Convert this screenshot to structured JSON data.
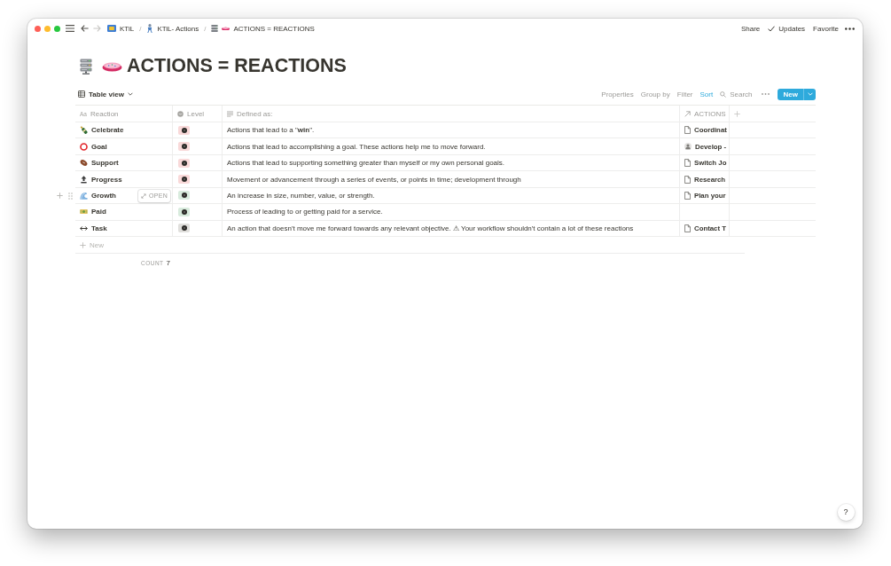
{
  "window": {
    "nav": [
      {
        "kind": "back",
        "disabled": false
      },
      {
        "kind": "forward",
        "disabled": true
      }
    ],
    "breadcrumbs": [
      {
        "label": "KTiL"
      },
      {
        "label": "KTiL- Actions",
        "separator": "/"
      },
      {
        "label": "ACTIONS = REACTIONS",
        "separator": "/"
      }
    ],
    "top_actions": [
      {
        "label": "Share",
        "kind": "plain"
      },
      {
        "label": "Updates",
        "kind": "check"
      },
      {
        "label": "Favorite",
        "kind": "plain"
      }
    ]
  },
  "page": {
    "title": "ACTIONS = REACTIONS"
  },
  "view": {
    "label": "Table view"
  },
  "toolbar": [
    {
      "label": "Properties",
      "kind": "plain",
      "active": false
    },
    {
      "label": "Group by",
      "kind": "plain",
      "active": false
    },
    {
      "label": "Filter",
      "kind": "plain",
      "active": false
    },
    {
      "label": "Sort",
      "kind": "plain",
      "active": true
    },
    {
      "label": "Search",
      "kind": "search",
      "active": false
    }
  ],
  "new_button": {
    "label": "New"
  },
  "table": {
    "columns": [
      {
        "label": "Reaction",
        "kind": "title",
        "glyph": "Aa"
      },
      {
        "label": "Level",
        "kind": "select"
      },
      {
        "label": "Defined as:",
        "kind": "text"
      },
      {
        "label": "ACTIONS",
        "kind": "relation"
      }
    ],
    "rows": [
      {
        "name": "Celebrate",
        "color": "#f9d9d9",
        "definition": "Actions that lead to a \"**win**\".",
        "action": {
          "title": "Coordinat",
          "kind": "page"
        },
        "hovered": false
      },
      {
        "name": "Goal",
        "color": "#f9d9d9",
        "definition": "Actions that lead to accomplishing a goal. These actions help me to move forward.",
        "action": {
          "title": "Develop -",
          "kind": "avatar"
        },
        "hovered": false
      },
      {
        "name": "Support",
        "color": "#f9d9d9",
        "definition": "Actions that lead to supporting something greater than myself or my own personal goals.",
        "action": {
          "title": "Switch Jo",
          "kind": "page"
        },
        "hovered": false
      },
      {
        "name": "Progress",
        "color": "#f9d9d9",
        "definition": "Movement or advancement through a series of events, or points in time; development through",
        "action": {
          "title": "Research",
          "kind": "page"
        },
        "hovered": false
      },
      {
        "name": "Growth",
        "color": "#d8ebdd",
        "definition": "An increase in size, number, value, or strength.",
        "action": {
          "title": "Plan your",
          "kind": "page"
        },
        "hovered": true
      },
      {
        "name": "Paid",
        "color": "#d8ebdd",
        "definition": "Process of leading to or getting paid for a service.",
        "hovered": false
      },
      {
        "name": "Task",
        "color": "#e0dfdc",
        "definition": "An action that doesn't move me forward towards any relevant objective. ⚠ Your workflow shouldn't contain a lot of these reactions",
        "action": {
          "title": "Contact T",
          "kind": "page"
        },
        "hovered": false
      }
    ],
    "open_button": {
      "label": "OPEN"
    },
    "new_row": {
      "label": "New"
    },
    "count": {
      "label": "COUNT",
      "value": "7"
    }
  },
  "help_button": {
    "label": "?"
  }
}
